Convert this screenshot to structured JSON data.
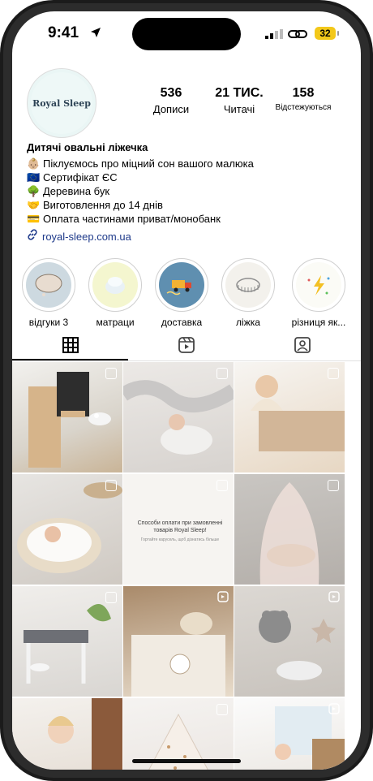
{
  "status_bar": {
    "time": "9:41",
    "battery": "32"
  },
  "profile": {
    "avatar_text": "Royal Sleep",
    "stats": [
      {
        "value": "536",
        "label": "Дописи"
      },
      {
        "value": "21 ТИС.",
        "label": "Читачі"
      },
      {
        "value": "158",
        "label": "Відстежуються"
      }
    ],
    "name": "Дитячі овальні ліжечка",
    "bio": [
      {
        "emoji": "👶🏼",
        "text": "Піклуємось про міцний сон вашого малюка"
      },
      {
        "emoji": "🇪🇺",
        "text": "Сертифікат ЄС"
      },
      {
        "emoji": "🌳",
        "text": "Деревина бук"
      },
      {
        "emoji": "🤝",
        "text": "Виготовлення до 14 днів"
      },
      {
        "emoji": "💳",
        "text": "Оплата частинами приват/монобанк"
      }
    ],
    "link": "royal-sleep.com.ua"
  },
  "highlights": [
    {
      "label": "відгуки 3",
      "icon": "speech-bubble"
    },
    {
      "label": "матраци",
      "icon": "mattress"
    },
    {
      "label": "доставка",
      "icon": "delivery-truck"
    },
    {
      "label": "ліжка",
      "icon": "crib"
    },
    {
      "label": "різниця як...",
      "icon": "lightning"
    }
  ],
  "tabs": [
    "grid-icon",
    "reels-icon",
    "tagged-icon"
  ],
  "posts": [
    {
      "type": "photo"
    },
    {
      "type": "photo"
    },
    {
      "type": "photo"
    },
    {
      "type": "photo"
    },
    {
      "type": "text",
      "title": "Способи оплати при замовленні товарів Royal Sleep!",
      "subtitle": "Гортайте карусель, щоб дізнатись більше"
    },
    {
      "type": "photo"
    },
    {
      "type": "photo"
    },
    {
      "type": "reel"
    },
    {
      "type": "reel"
    },
    {
      "type": "photo"
    },
    {
      "type": "photo"
    },
    {
      "type": "photo"
    }
  ],
  "colors": {
    "battery": "#f3c81a",
    "link": "#1e3a8a",
    "accent": "#000000"
  }
}
